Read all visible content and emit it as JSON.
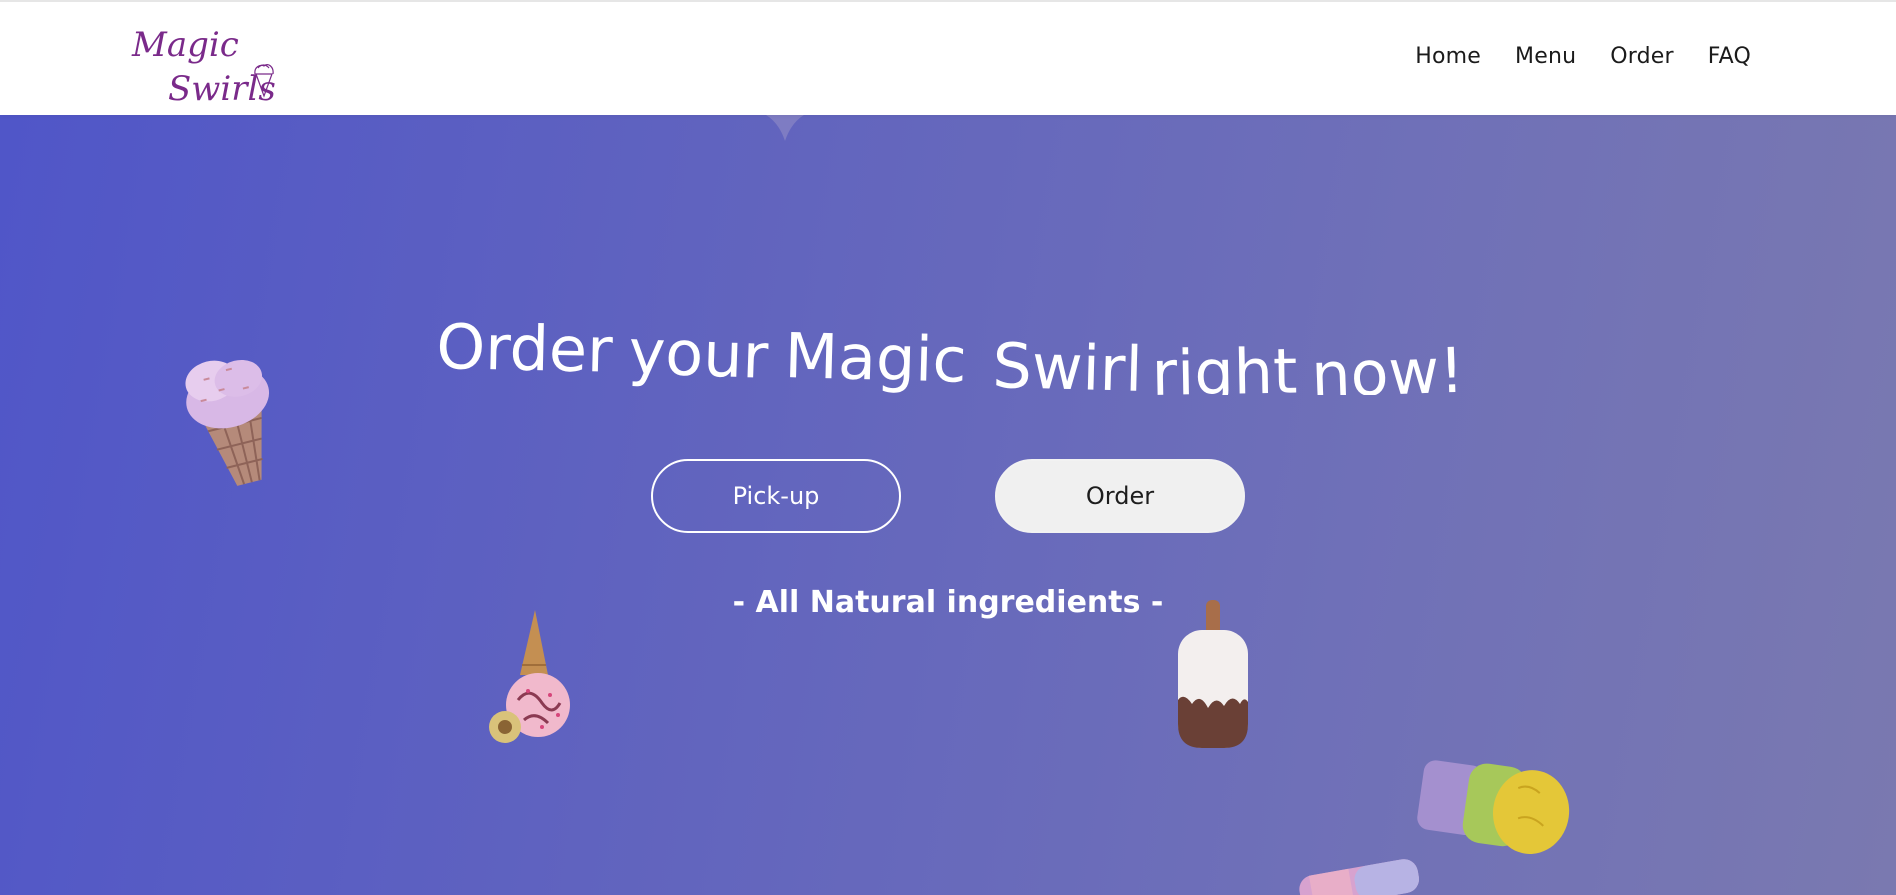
{
  "brand": {
    "logo_line1": "Magic",
    "logo_line2": "Swirls"
  },
  "nav": {
    "items": [
      "Home",
      "Menu",
      "Order",
      "FAQ"
    ]
  },
  "hero": {
    "title_words": [
      "Order",
      "your",
      "Magic",
      "Swirl",
      "right",
      "now!"
    ],
    "buttons": {
      "pickup": "Pick-up",
      "order": "Order"
    },
    "tagline": "- All Natural ingredients -"
  },
  "colors": {
    "accent_brand": "#7a2a8a",
    "hero_gradient_start": "#5056c8",
    "hero_gradient_end": "#7a79b0"
  },
  "decorations": [
    "ice-cream-cone-icon",
    "upside-down-cone-icon",
    "popsicle-icon",
    "ice-cream-cup-icon",
    "popsicle-stick-icon"
  ]
}
